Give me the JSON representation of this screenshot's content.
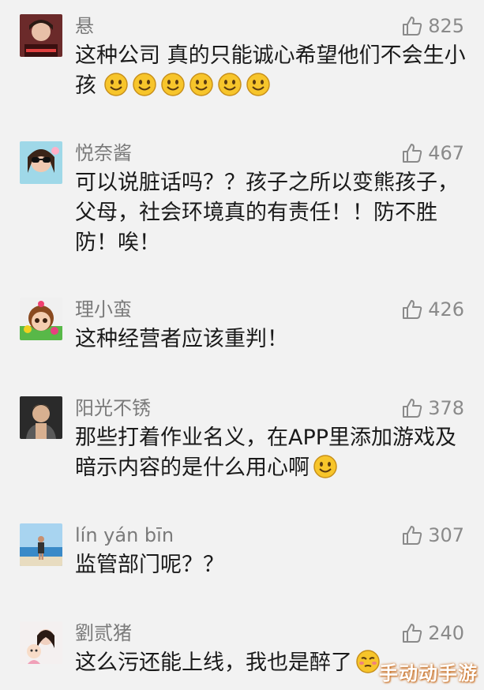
{
  "comments": [
    {
      "name": "悬",
      "likes": "825",
      "text": "这种公司 真的只能诚心希望他们不会生小孩",
      "emoji": "smile-emoji",
      "emoji_count": 6
    },
    {
      "name": "悦奈酱",
      "likes": "467",
      "text": "可以说脏话吗？？孩子之所以变熊孩子，父母，社会环境真的有责任！！防不胜防！唉！"
    },
    {
      "name": "理小蛮",
      "likes": "426",
      "text": "这种经营者应该重判！"
    },
    {
      "name": "阳光不锈",
      "likes": "378",
      "text": "那些打着作业名义，在APP里添加游戏及暗示内容的是什么用心啊",
      "emoji": "smile-emoji",
      "emoji_count": 1
    },
    {
      "name": "lín yán bīn",
      "likes": "307",
      "text": "监管部门呢？？"
    },
    {
      "name": "劉贰猪",
      "likes": "240",
      "text": "这么污还能上线，我也是醉了",
      "emoji": "drunk-emoji",
      "emoji_count": 1
    }
  ],
  "icons": {
    "like": "thumbs-up-icon"
  },
  "colors": {
    "background": "#f2f2f2",
    "secondary_text": "#7a7a7a",
    "emoji_yellow": "#f7c52b"
  },
  "watermark": "手动动手游"
}
